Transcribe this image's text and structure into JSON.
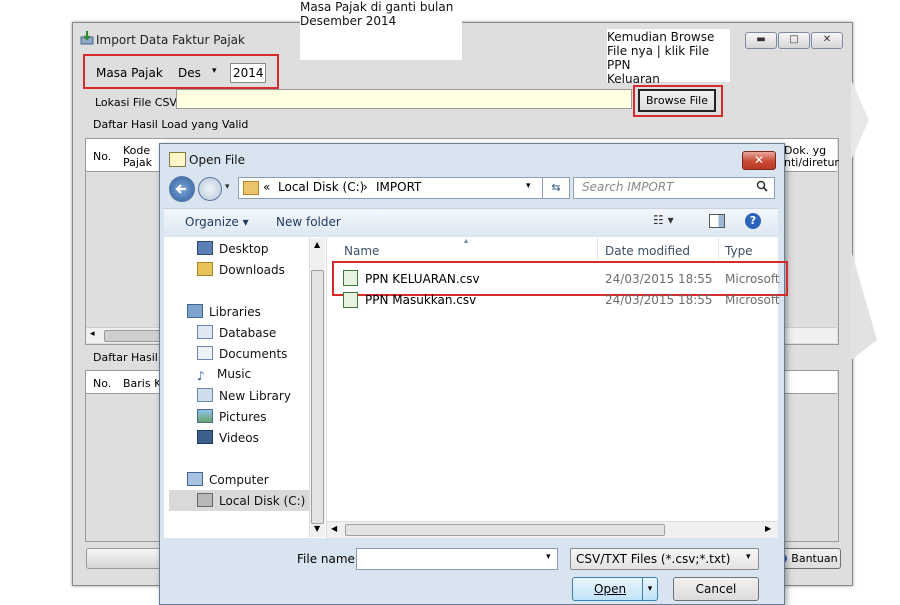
{
  "annotations": {
    "note1": [
      "Masa Pajak di ganti bulan",
      "Desember 2014"
    ],
    "note2": [
      "Kemudian Browse",
      "File nya | klik File PPN",
      "Keluaran"
    ]
  },
  "main_window": {
    "title": "Import Data Faktur Pajak",
    "masa_pajak_label": "Masa Pajak",
    "month_value": "Des",
    "year_value": "2014",
    "lokasi_label": "Lokasi File CSV",
    "lokasi_value": "",
    "browse_label": "Browse File",
    "valid_list_label": "Daftar Hasil Load yang Valid",
    "valid_columns": [
      "No.",
      "Kode",
      "Pajak",
      "Dok. yg",
      "nti/diretur"
    ],
    "second_list_label": "Daftar Hasil L",
    "second_columns": [
      "No.",
      "Baris Ke"
    ],
    "bantuan_label": "Bantuan"
  },
  "dialog": {
    "title": "Open File",
    "breadcrumb": [
      "«",
      "Local Disk (C:)",
      "›",
      "IMPORT"
    ],
    "search_placeholder": "Search IMPORT",
    "organize_label": "Organize ▾",
    "new_folder_label": "New folder",
    "nav_items": [
      {
        "label": "Desktop",
        "icon": "desktop-icon"
      },
      {
        "label": "Downloads",
        "icon": "downloads-icon"
      },
      {
        "label": "Libraries",
        "icon": "libraries-icon"
      },
      {
        "label": "Database",
        "icon": "database-icon"
      },
      {
        "label": "Documents",
        "icon": "documents-icon"
      },
      {
        "label": "Music",
        "icon": "music-icon"
      },
      {
        "label": "New Library",
        "icon": "library-icon"
      },
      {
        "label": "Pictures",
        "icon": "pictures-icon"
      },
      {
        "label": "Videos",
        "icon": "videos-icon"
      },
      {
        "label": "Computer",
        "icon": "computer-icon"
      },
      {
        "label": "Local Disk (C:)",
        "icon": "disk-icon"
      }
    ],
    "columns": {
      "name": "Name",
      "date": "Date modified",
      "type": "Type"
    },
    "files": [
      {
        "name": "PPN KELUARAN.csv",
        "date": "24/03/2015 18:55",
        "type": "Microsoft"
      },
      {
        "name": "PPN Masukkan.csv",
        "date": "24/03/2015 18:55",
        "type": "Microsoft"
      }
    ],
    "filename_label": "File name:",
    "filename_value": "",
    "filter_value": "CSV/TXT Files (*.csv;*.txt)",
    "open_label": "Open",
    "cancel_label": "Cancel"
  }
}
